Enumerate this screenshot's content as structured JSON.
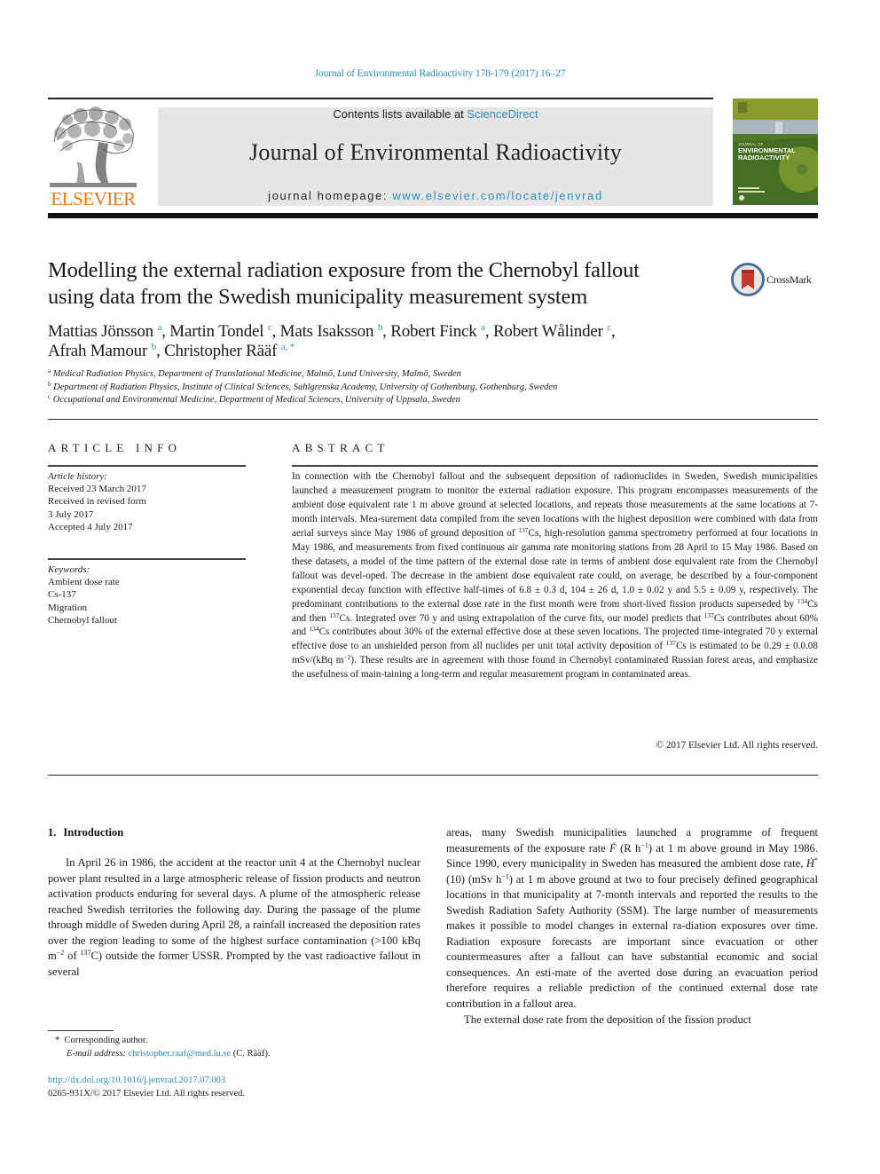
{
  "header": {
    "journal_ref": "Journal of Environmental Radioactivity 178-179 (2017) 16–27",
    "publisher_logo_text": "ELSEVIER",
    "contents_prefix": "Contents lists available at ",
    "contents_link": "ScienceDirect",
    "journal_title": "Journal of Environmental Radioactivity",
    "homepage_prefix": "journal homepage: ",
    "homepage_link": "www.elsevier.com/locate/jenvrad",
    "cover_title_line1": "JOURNAL OF",
    "cover_title_line2": "ENVIRONMENTAL",
    "cover_title_line3": "RADIOACTIVITY",
    "colors": {
      "link": "#2a8fbd",
      "elsevier_orange": "#f07a12",
      "masthead_bg": "#e6e6e6"
    }
  },
  "article": {
    "title_line1": "Modelling the external radiation exposure from the Chernobyl fallout",
    "title_line2": "using data from the Swedish municipality measurement system",
    "crossmark_label": "CrossMark",
    "authors": [
      {
        "name": "Mattias Jönsson",
        "aff": "a",
        "sep": ", "
      },
      {
        "name": "Martin Tondel",
        "aff": "c",
        "sep": ", "
      },
      {
        "name": "Mats Isaksson",
        "aff": "b",
        "sep": ", "
      },
      {
        "name": "Robert Finck",
        "aff": "a",
        "sep": ", "
      },
      {
        "name": "Robert Wålinder",
        "aff": "c",
        "sep": ","
      },
      {
        "name": "Afrah Mamour",
        "aff": "b",
        "sep": ", "
      },
      {
        "name": "Christopher Rääf",
        "aff": "a, *",
        "sep": ""
      }
    ],
    "affiliations": [
      {
        "key": "a",
        "text": "Medical Radiation Physics, Department of Translational Medicine, Malmö, Lund University, Malmö, Sweden"
      },
      {
        "key": "b",
        "text": "Department of Radiation Physics, Institute of Clinical Sciences, Sahlgrenska Academy, University of Gothenburg, Gothenburg, Sweden"
      },
      {
        "key": "c",
        "text": "Occupational and Environmental Medicine, Department of Medical Sciences, University of Uppsala, Sweden"
      }
    ]
  },
  "article_info": {
    "heading": "ARTICLE INFO",
    "history_label": "Article history:",
    "history": [
      "Received 23 March 2017",
      "Received in revised form",
      "3 July 2017",
      "Accepted 4 July 2017"
    ],
    "keywords_label": "Keywords:",
    "keywords": [
      "Ambient dose rate",
      "Cs-137",
      "Migration",
      "Chernobyl fallout"
    ]
  },
  "abstract": {
    "heading": "ABSTRACT",
    "seg1": "In connection with the Chernobyl fallout and the subsequent deposition of radionuclides in Sweden, Swedish municipalities launched a measurement program to monitor the external radiation exposure. This program encompasses measurements of the ambient dose equivalent rate 1 m above ground at selected locations, and repeats those measurements at the same locations at 7-month intervals. Mea-surement data compiled from the seven locations with the highest deposition were combined with data from aerial surveys since May 1986 of ground deposition of ",
    "iso137": "137",
    "seg2": "Cs, high-resolution gamma spectrometry performed at four locations in May 1986, and measurements from fixed continuous air gamma rate monitoring stations from 28 April to 15 May 1986. Based on these datasets, a model of the time pattern of the external dose rate in terms of ambient dose equivalent rate from the Chernobyl fallout was devel-oped. The decrease in the ambient dose equivalent rate could, on average, be described by a four-component exponential decay function with effective half-times of 6.8 ± 0.3 d, 104 ± 26 d, 1.0 ± 0.02 y and 5.5 ± 0.09 y, respectively. The predominant contributions to the external dose rate in the first month were from short-lived fission products superseded by ",
    "iso134": "134",
    "seg3": "Cs and then ",
    "seg4": "Cs. Integrated over 70 y and using extrapolation of the curve fits, our model predicts that ",
    "seg5": "Cs contributes about 60% and ",
    "seg6": "Cs contributes about 30% of the external effective dose at these seven locations. The projected time-integrated 70 y external effective dose to an unshielded person from all nuclides per unit total activity deposition of ",
    "seg7": "Cs is estimated to be 0.29 ± 0.0.08 mSv/(kBq m",
    "exp_m2": "−2",
    "seg8": "). These results are in agreement with those found in Chernobyl contaminated Russian forest areas, and emphasize the usefulness of main-taining a long-term and regular measurement program in contaminated areas.",
    "copyright": "© 2017 Elsevier Ltd. All rights reserved."
  },
  "introduction": {
    "number": "1.",
    "heading": "Introduction",
    "left_seg1": "In April 26 in 1986, the accident at the reactor unit 4 at the Chernobyl nuclear power plant resulted in a large atmospheric release of fission products and neutron activation products enduring for several days. A plume of the atmospheric release reached Swedish territories the following day. During the passage of the plume through middle of Sweden during April 28, a rainfall increased the deposition rates over the region leading to some of the highest surface contamination (>100 kBq m",
    "left_exp": "−2",
    "left_seg2": " of ",
    "left_iso": "137",
    "left_seg3": "C) outside the former USSR. Prompted by the vast radioactive fallout in several",
    "right_seg1": "areas, many Swedish municipalities launched a programme of frequent measurements of the exposure rate ",
    "right_sym_f": "Ẋ",
    "right_sym_f_display": "Ḟ",
    "right_seg2": " (R h",
    "right_exp1": "−1",
    "right_seg3": ") at 1 m above ground in May 1986. Since 1990, every municipality in Sweden has measured the ambient dose rate, ",
    "right_sym_h": "Ḣ",
    "right_sym_h_sup": "*",
    "right_seg4": "(10) (mSv h",
    "right_exp2": "−1",
    "right_seg5": ") at 1 m above ground at two to four precisely defined geographical locations in that municipality at 7-month intervals and reported the results to the Swedish Radiation Safety Authority (SSM). The large number of measurements makes it possible to model changes in external ra-diation exposures over time. Radiation exposure forecasts are important since evacuation or other countermeasures after a fallout can have substantial economic and social consequences. An esti-mate of the averted dose during an evacuation period therefore requires a reliable prediction of the continued external dose rate contribution in a fallout area.",
    "right_p2": "The external dose rate from the deposition of the fission product"
  },
  "footnotes": {
    "star": "*",
    "corresponding": "Corresponding author.",
    "email_label": "E-mail address:",
    "email": "christopher.raaf@med.lu.se",
    "email_suffix": " (C. Rääf).",
    "doi": "http://dx.doi.org/10.1016/j.jenvrad.2017.07.003",
    "issn_line": "0265-931X/© 2017 Elsevier Ltd. All rights reserved."
  }
}
